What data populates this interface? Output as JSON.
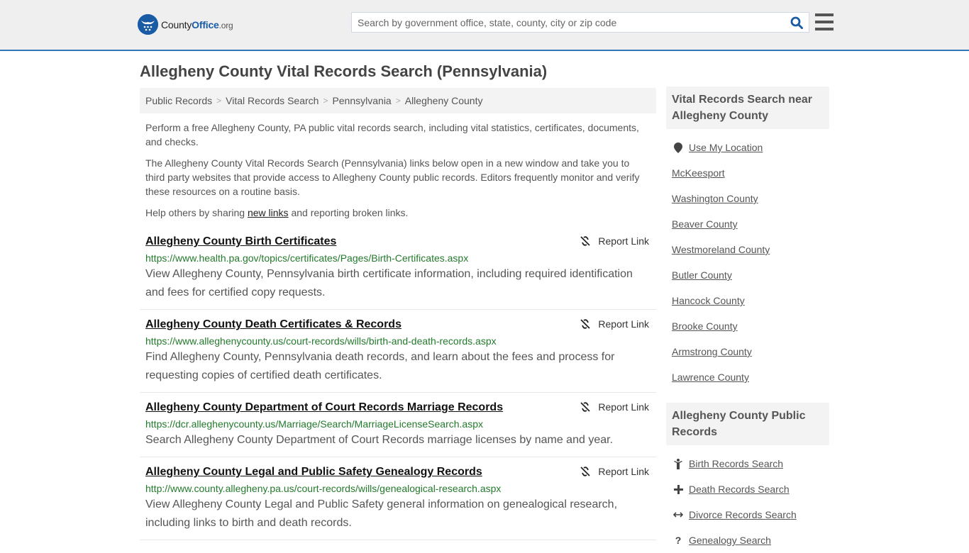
{
  "header": {
    "logo": {
      "name_part1": "County",
      "name_part2": "Office",
      "tld": ".org"
    },
    "search": {
      "placeholder": "Search by government office, state, county, city or zip code",
      "value": ""
    },
    "colors": {
      "accent": "#2f78b5",
      "brand_blue": "#1a5ba6",
      "url_green": "#237a2c"
    }
  },
  "page": {
    "title": "Allegheny County Vital Records Search (Pennsylvania)",
    "breadcrumb": [
      "Public Records",
      "Vital Records Search",
      "Pennsylvania",
      "Allegheny County"
    ],
    "intro": {
      "p1": "Perform a free Allegheny County, PA public vital records search, including vital statistics, certificates, documents, and checks.",
      "p2": "The Allegheny County Vital Records Search (Pennsylvania) links below open in a new window and take you to third party websites that provide access to Allegheny County public records. Editors frequently monitor and verify these resources on a routine basis.",
      "p3_before": "Help others by sharing ",
      "p3_link": "new links",
      "p3_after": " and reporting broken links."
    },
    "report_label": "Report Link",
    "results": [
      {
        "title": "Allegheny County Birth Certificates",
        "url": "https://www.health.pa.gov/topics/certificates/Pages/Birth-Certificates.aspx",
        "desc": "View Allegheny County, Pennsylvania birth certificate information, including required identification and fees for certified copy requests."
      },
      {
        "title": "Allegheny County Death Certificates & Records",
        "url": "https://www.alleghenycounty.us/court-records/wills/birth-and-death-records.aspx",
        "desc": "Find Allegheny County, Pennsylvania death records, and learn about the fees and process for requesting copies of certified death certificates."
      },
      {
        "title": "Allegheny County Department of Court Records Marriage Records",
        "url": "https://dcr.alleghenycounty.us/Marriage/Search/MarriageLicenseSearch.aspx",
        "desc": "Search Allegheny County Department of Court Records marriage licenses by name and year."
      },
      {
        "title": "Allegheny County Legal and Public Safety Genealogy Records",
        "url": "http://www.county.allegheny.pa.us/court-records/wills/genealogical-research.aspx",
        "desc": "View Allegheny County Legal and Public Safety general information on genealogical research, including links to birth and death records."
      }
    ]
  },
  "sidebar": {
    "nearby": {
      "heading": "Vital Records Search near Allegheny County",
      "use_location": "Use My Location",
      "items": [
        "McKeesport",
        "Washington County",
        "Beaver County",
        "Westmoreland County",
        "Butler County",
        "Hancock County",
        "Brooke County",
        "Armstrong County",
        "Lawrence County"
      ]
    },
    "public_records": {
      "heading": "Allegheny County Public Records",
      "items": [
        {
          "label": "Birth Records Search",
          "icon": "child-icon"
        },
        {
          "label": "Death Records Search",
          "icon": "cross-icon"
        },
        {
          "label": "Divorce Records Search",
          "icon": "arrows-horizontal-icon"
        },
        {
          "label": "Genealogy Search",
          "icon": "question-icon"
        }
      ]
    }
  }
}
